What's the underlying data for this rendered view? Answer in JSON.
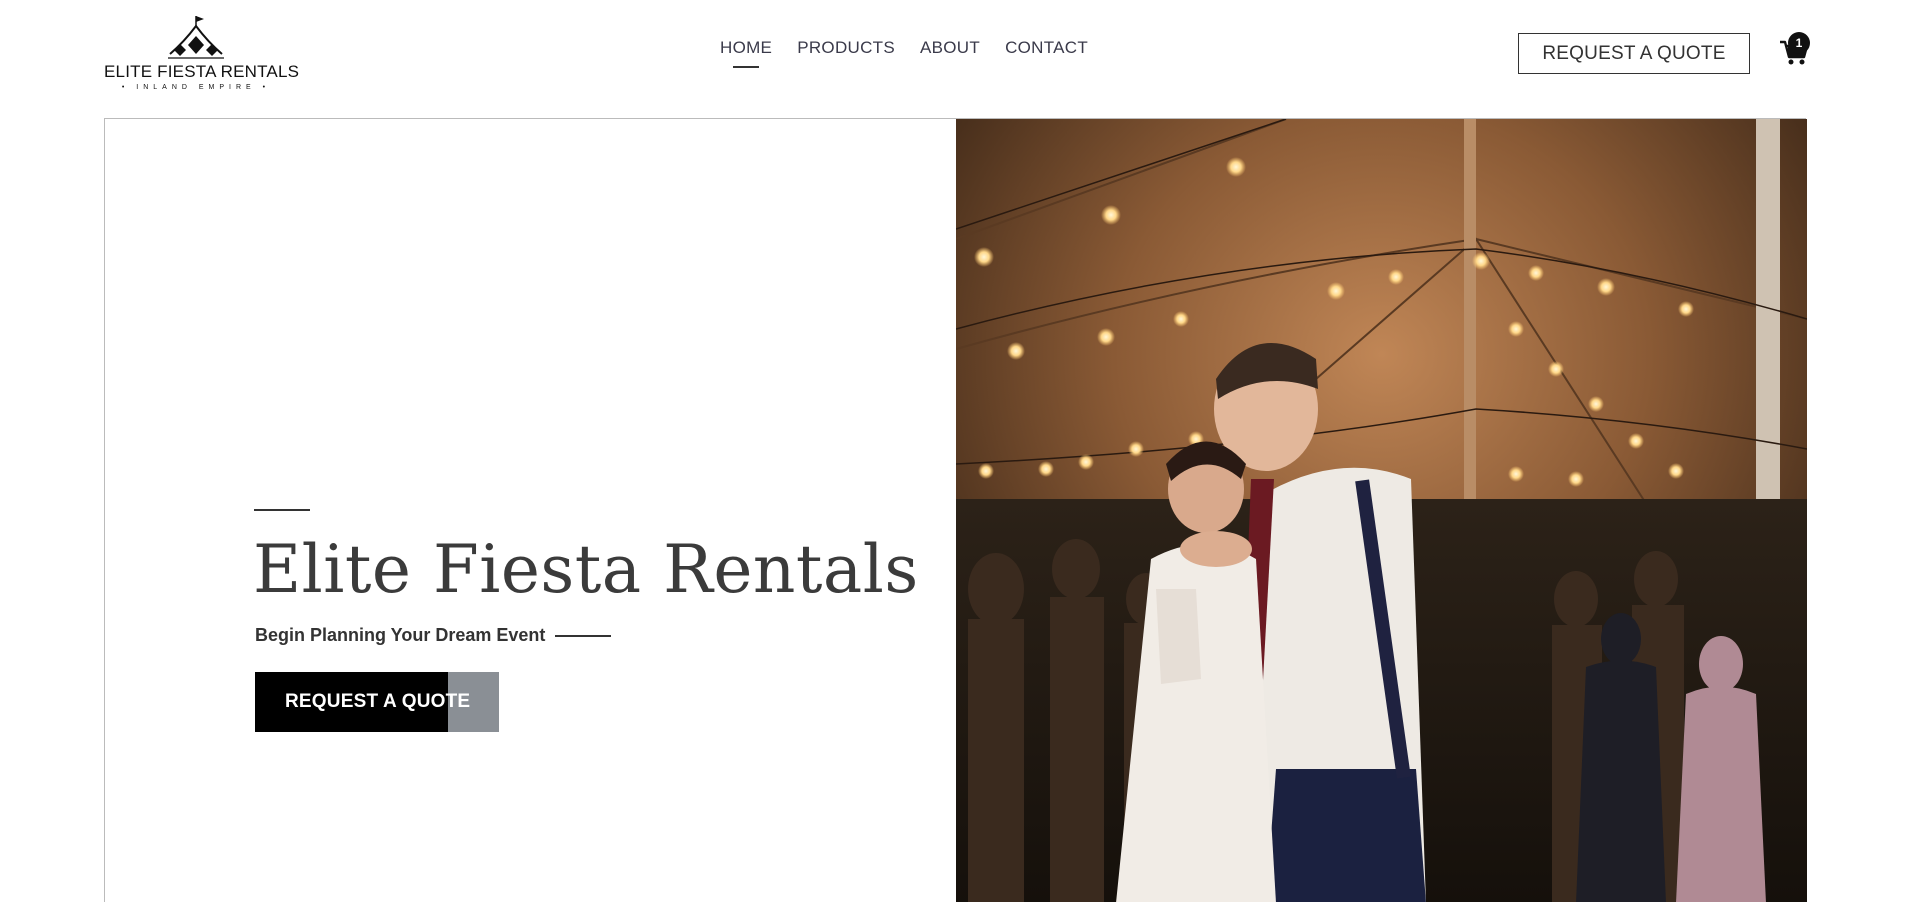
{
  "brand": {
    "name": "ELITE FIESTA RENTALS",
    "tagline": "INLAND EMPIRE"
  },
  "nav": {
    "items": [
      {
        "label": "HOME",
        "active": true
      },
      {
        "label": "PRODUCTS",
        "active": false
      },
      {
        "label": "ABOUT",
        "active": false
      },
      {
        "label": "CONTACT",
        "active": false
      }
    ]
  },
  "header": {
    "quote_label": "REQUEST A QUOTE",
    "cart_icon": "shopping-cart-icon",
    "cart_count": "1"
  },
  "hero": {
    "title": "Elite Fiesta Rentals",
    "subtitle": "Begin Planning Your Dream Event",
    "cta_label": "REQUEST A QUOTE",
    "image_alt": "wedding-couple-dancing-photo"
  },
  "colors": {
    "accent": "#000000",
    "text": "#333333",
    "cta_overlay": "#8a8f95"
  }
}
